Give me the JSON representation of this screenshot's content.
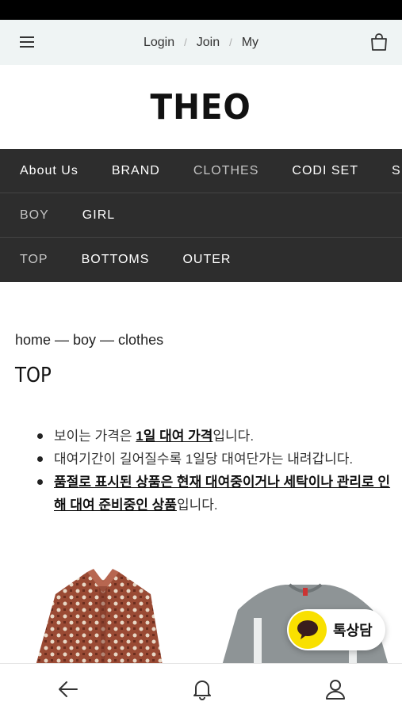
{
  "topbar": {
    "login": "Login",
    "join": "Join",
    "my": "My",
    "separator": "/"
  },
  "brand": {
    "logo": "THEO"
  },
  "nav": {
    "main": [
      "About Us",
      "BRAND",
      "CLOTHES",
      "CODI SET",
      "S"
    ],
    "gender": [
      "BOY",
      "GIRL"
    ],
    "category": [
      "TOP",
      "BOTTOMS",
      "OUTER"
    ]
  },
  "breadcrumb": "home — boy — clothes",
  "page_title": "TOP",
  "notices": {
    "n1_pre": "보이는 가격은 ",
    "n1_bold": "1일 대여 가격",
    "n1_post": "입니다.",
    "n2": "대여기간이 길어질수록 1일당 대여단가는 내려갑니다.",
    "n3_bold": "품절로 표시된 상품은 현재 대여중이거나 세탁이나 관리로 인해 대여 준비중인 상품",
    "n3_post": "입니다."
  },
  "chat": {
    "label": "톡상담",
    "color": "#f9e000"
  },
  "icons": {
    "menu": "hamburger-menu-icon",
    "bag": "shopping-bag-icon",
    "back": "back-arrow-icon",
    "bell": "bell-icon",
    "user": "user-icon",
    "chat": "chat-bubble-icon"
  },
  "colors": {
    "nav_bg": "#2d2d2d",
    "topbar_bg": "#eff4f4"
  }
}
